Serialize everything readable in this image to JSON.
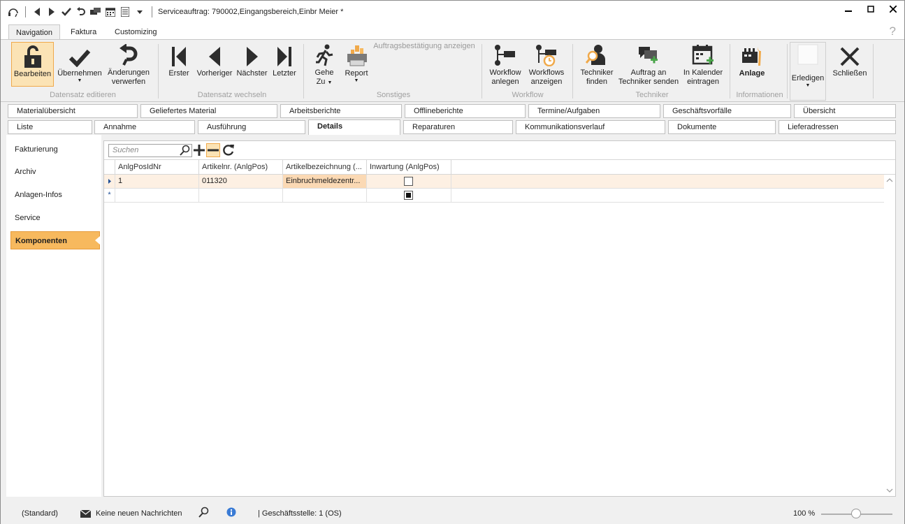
{
  "title": "Serviceauftrag: 790002,Eingangsbereich,Einbr Meier *",
  "ribbon_tabs": [
    "Navigation",
    "Faktura",
    "Customizing"
  ],
  "help_label": "?",
  "ribbon": {
    "bearbeiten": "Bearbeiten",
    "uebernehmen": "Übernehmen",
    "aenderungen": [
      "Änderungen",
      "verwerfen"
    ],
    "erster": "Erster",
    "vorheriger": "Vorheriger",
    "naechster": "Nächster",
    "letzter": "Letzter",
    "gehe_zu": [
      "Gehe",
      "Zu"
    ],
    "report": "Report",
    "auftragsbestaetigung": "Auftragsbestätigung anzeigen",
    "workflow_anlegen": [
      "Workflow",
      "anlegen"
    ],
    "workflows_anzeigen": [
      "Workflows",
      "anzeigen"
    ],
    "techniker_finden": [
      "Techniker",
      "finden"
    ],
    "auftrag_senden": [
      "Auftrag an",
      "Techniker senden"
    ],
    "in_kalender": [
      "In Kalender",
      "eintragen"
    ],
    "anlage": "Anlage",
    "erledigen": "Erledigen",
    "schliessen": "Schließen",
    "groups": {
      "datensatz_editieren": "Datensatz editieren",
      "datensatz_wechseln": "Datensatz wechseln",
      "sonstiges": "Sonstiges",
      "workflow": "Workflow",
      "techniker": "Techniker",
      "informationen": "Informationen"
    }
  },
  "tabs_row1": [
    "Materialübersicht",
    "Geliefertes Material",
    "Arbeitsberichte",
    "Offlineberichte",
    "Termine/Aufgaben",
    "Geschäftsvorfälle",
    "Übersicht"
  ],
  "tabs_row2": [
    "Liste",
    "Annahme",
    "Ausführung",
    "Details",
    "Reparaturen",
    "Kommunikationsverlauf",
    "Dokumente",
    "Lieferadressen"
  ],
  "left_nav": [
    "Fakturierung",
    "Archiv",
    "Anlagen-Infos",
    "Service",
    "Komponenten"
  ],
  "search": {
    "placeholder": "Suchen"
  },
  "grid": {
    "columns": [
      "AnlgPosIdNr",
      "Artikelnr. (AnlgPos)",
      "Artikelbezeichnung (...",
      "Inwartung (AnlgPos)"
    ],
    "rows": [
      {
        "id": "1",
        "artikelnr": "011320",
        "bezeichnung": "Einbruchmeldezentr...",
        "inwartung": false
      }
    ],
    "new_row_marker": "*"
  },
  "status": {
    "layout": "(Standard)",
    "messages": "Keine neuen Nachrichten",
    "geschaeftsstelle": "| Geschäftsstelle:  1 (OS)",
    "zoom": "100 %",
    "zoom_level": 100
  },
  "colors": {
    "accent": "#f7b95e",
    "selected_row": "#fdf0e3",
    "selected_cell": "#fbd9b4",
    "tool_icon": "#2d2d2d",
    "info_icon": "#3a7bd5"
  }
}
